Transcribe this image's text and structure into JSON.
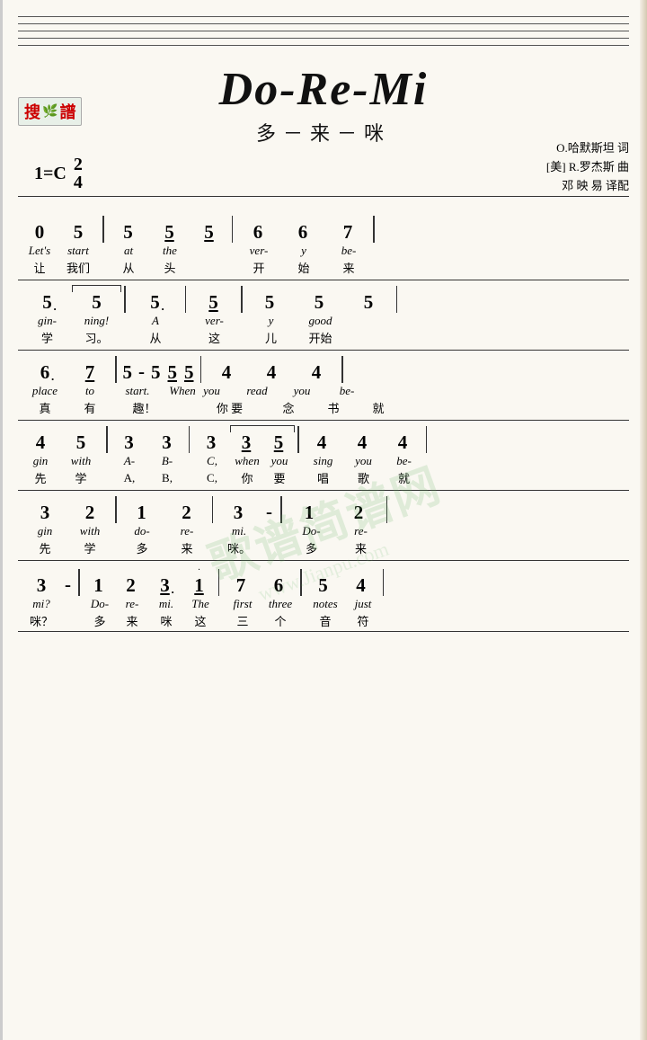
{
  "title": {
    "main": "Do-Re-Mi",
    "chinese": "多－来－咪"
  },
  "logo": {
    "text_red": "搜",
    "text_green": "♪",
    "text_last": "谱",
    "sub": "www.jianpu.com"
  },
  "credits": {
    "line1": "O.哈默斯坦 词",
    "line2": "[美] R.罗杰斯 曲",
    "line3": "邓 映 易 译配"
  },
  "key": "1=C",
  "time": {
    "top": "2",
    "bottom": "4"
  },
  "systems": [
    {
      "id": "sys1",
      "notes": "0  5  |  5  5̲  5̲  |  6  6  7",
      "eng": "Let's  start  at  the  ver- y  be-",
      "cn": "让    我们   从   头    开  始  来"
    },
    {
      "id": "sys2",
      "notes": "5.  5  |  5.  |  5̲  |  5  5  5",
      "eng": "gin- ning!  A  ver- y  good",
      "cn": "学  习。   从   这  儿  开始"
    },
    {
      "id": "sys3",
      "notes": "6.  7̲  |  5 - 5  5̲  5̲  |  4  4  4",
      "eng": "place  to  start.  When you  read  you  be-",
      "cn": "真  有   趣！    你  要   念  书  就"
    },
    {
      "id": "sys4",
      "notes": "4  5  |  3  3  |  3  3̲  5̲  |  4  4  4",
      "eng": "gin  with  A- B- C,  when  you  sing  you  be-",
      "cn": "先  学   A,  B,  C,  你  要   唱  歌  就"
    },
    {
      "id": "sys5",
      "notes": "3  2  |  1  2  |  3 -  |  1  2",
      "eng": "gin  with  do- re- mi.  Do- re-",
      "cn": "先  学   多  来   咪。  多  来"
    },
    {
      "id": "sys6",
      "notes": "3 -  |  1  2  3.  i̲  |  7  6  |  5  4",
      "eng": "mi?  Do- re- mi. The  first  three  notes  just",
      "cn": "咪？  多  来  咪  这   三  个   音  符"
    }
  ],
  "watermark": {
    "text1": "歌谱简谱网",
    "text2": "www.Jianpu.com"
  }
}
